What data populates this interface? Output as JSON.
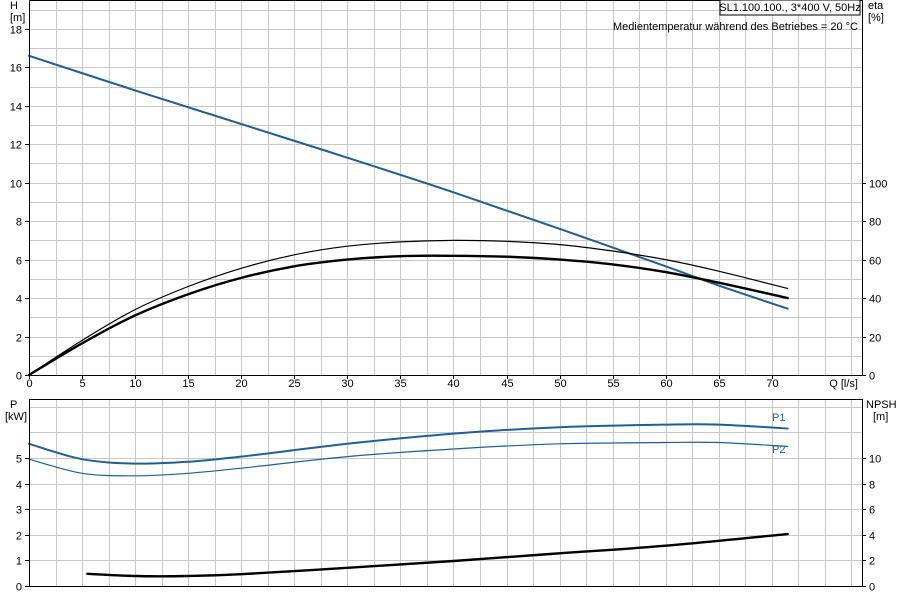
{
  "header": {
    "model_label": "SL1.100.100., 3*400 V, 50Hz",
    "temperature_note": "Medientemperatur während des Betriebes = 20 °C"
  },
  "chart_data": [
    {
      "type": "line",
      "panel": "head",
      "ylabel_left": "H",
      "yunit_left": "[m]",
      "ylabel_right": "eta",
      "yunit_right": "[%]",
      "xlabel": "Q [l/s]",
      "xlim": [
        0,
        78.5
      ],
      "xticks": [
        0,
        5,
        10,
        15,
        20,
        25,
        30,
        35,
        40,
        45,
        50,
        55,
        60,
        65,
        70
      ],
      "ylim_left": [
        0,
        19.5
      ],
      "yticks_left": [
        0,
        2,
        4,
        6,
        8,
        10,
        12,
        14,
        16,
        18
      ],
      "ylim_right": [
        0,
        195
      ],
      "yticks_right": [
        0,
        20,
        40,
        60,
        80,
        100
      ],
      "grid": true,
      "series": [
        {
          "role": "head",
          "axis": "left",
          "color": "#1f5f95",
          "x": [
            0,
            10,
            20,
            30,
            40,
            50,
            60,
            65,
            71.5
          ],
          "y": [
            16.6,
            14.8,
            13.05,
            11.3,
            9.5,
            7.6,
            5.65,
            4.65,
            3.45
          ]
        },
        {
          "role": "efficiency-thin",
          "axis": "right",
          "color": "#000000",
          "x": [
            0,
            5,
            10,
            15,
            20,
            25,
            30,
            35,
            40,
            45,
            50,
            55,
            60,
            65,
            71.5
          ],
          "y": [
            0,
            18,
            34,
            46,
            55.5,
            62.5,
            67,
            69.2,
            70,
            69.5,
            67.8,
            64.5,
            60,
            54,
            45
          ]
        },
        {
          "role": "efficiency-bold",
          "axis": "right",
          "color": "#000000",
          "x": [
            0,
            5,
            10,
            15,
            20,
            25,
            30,
            35,
            40,
            45,
            50,
            55,
            60,
            65,
            71.5
          ],
          "y": [
            0,
            16.5,
            31,
            42,
            50.5,
            56.5,
            60,
            61.8,
            62,
            61.5,
            60,
            57.5,
            53.5,
            48,
            40
          ]
        }
      ]
    },
    {
      "type": "line",
      "panel": "power",
      "ylabel_left": "P",
      "yunit_left": "[kW]",
      "ylabel_right": "NPSH",
      "yunit_right": "[m]",
      "xlim": [
        0,
        78.5
      ],
      "ylim_left": [
        0,
        7.3
      ],
      "yticks_left": [
        0,
        1,
        2,
        3,
        4,
        5
      ],
      "ylim_right": [
        0,
        14.6
      ],
      "yticks_right": [
        0,
        2,
        4,
        6,
        8,
        10
      ],
      "grid": true,
      "series": [
        {
          "name": "P1",
          "axis": "left",
          "color": "#1f5f95",
          "x": [
            0,
            5,
            10,
            15,
            20,
            30,
            40,
            50,
            60,
            65,
            71.5
          ],
          "y": [
            5.55,
            4.95,
            4.78,
            4.85,
            5.05,
            5.55,
            5.95,
            6.2,
            6.3,
            6.3,
            6.15
          ]
        },
        {
          "name": "P2",
          "axis": "left",
          "color": "#1f5f95",
          "x": [
            0,
            5,
            10,
            15,
            20,
            30,
            40,
            50,
            60,
            65,
            71.5
          ],
          "y": [
            4.95,
            4.4,
            4.3,
            4.4,
            4.6,
            5.05,
            5.35,
            5.55,
            5.6,
            5.6,
            5.45
          ]
        },
        {
          "role": "npsh",
          "axis": "right",
          "color": "#000000",
          "x": [
            5.5,
            10,
            15,
            20,
            30,
            40,
            50,
            60,
            71.5
          ],
          "y": [
            0.95,
            0.78,
            0.78,
            0.92,
            1.42,
            1.95,
            2.55,
            3.15,
            4.05
          ]
        }
      ]
    }
  ]
}
